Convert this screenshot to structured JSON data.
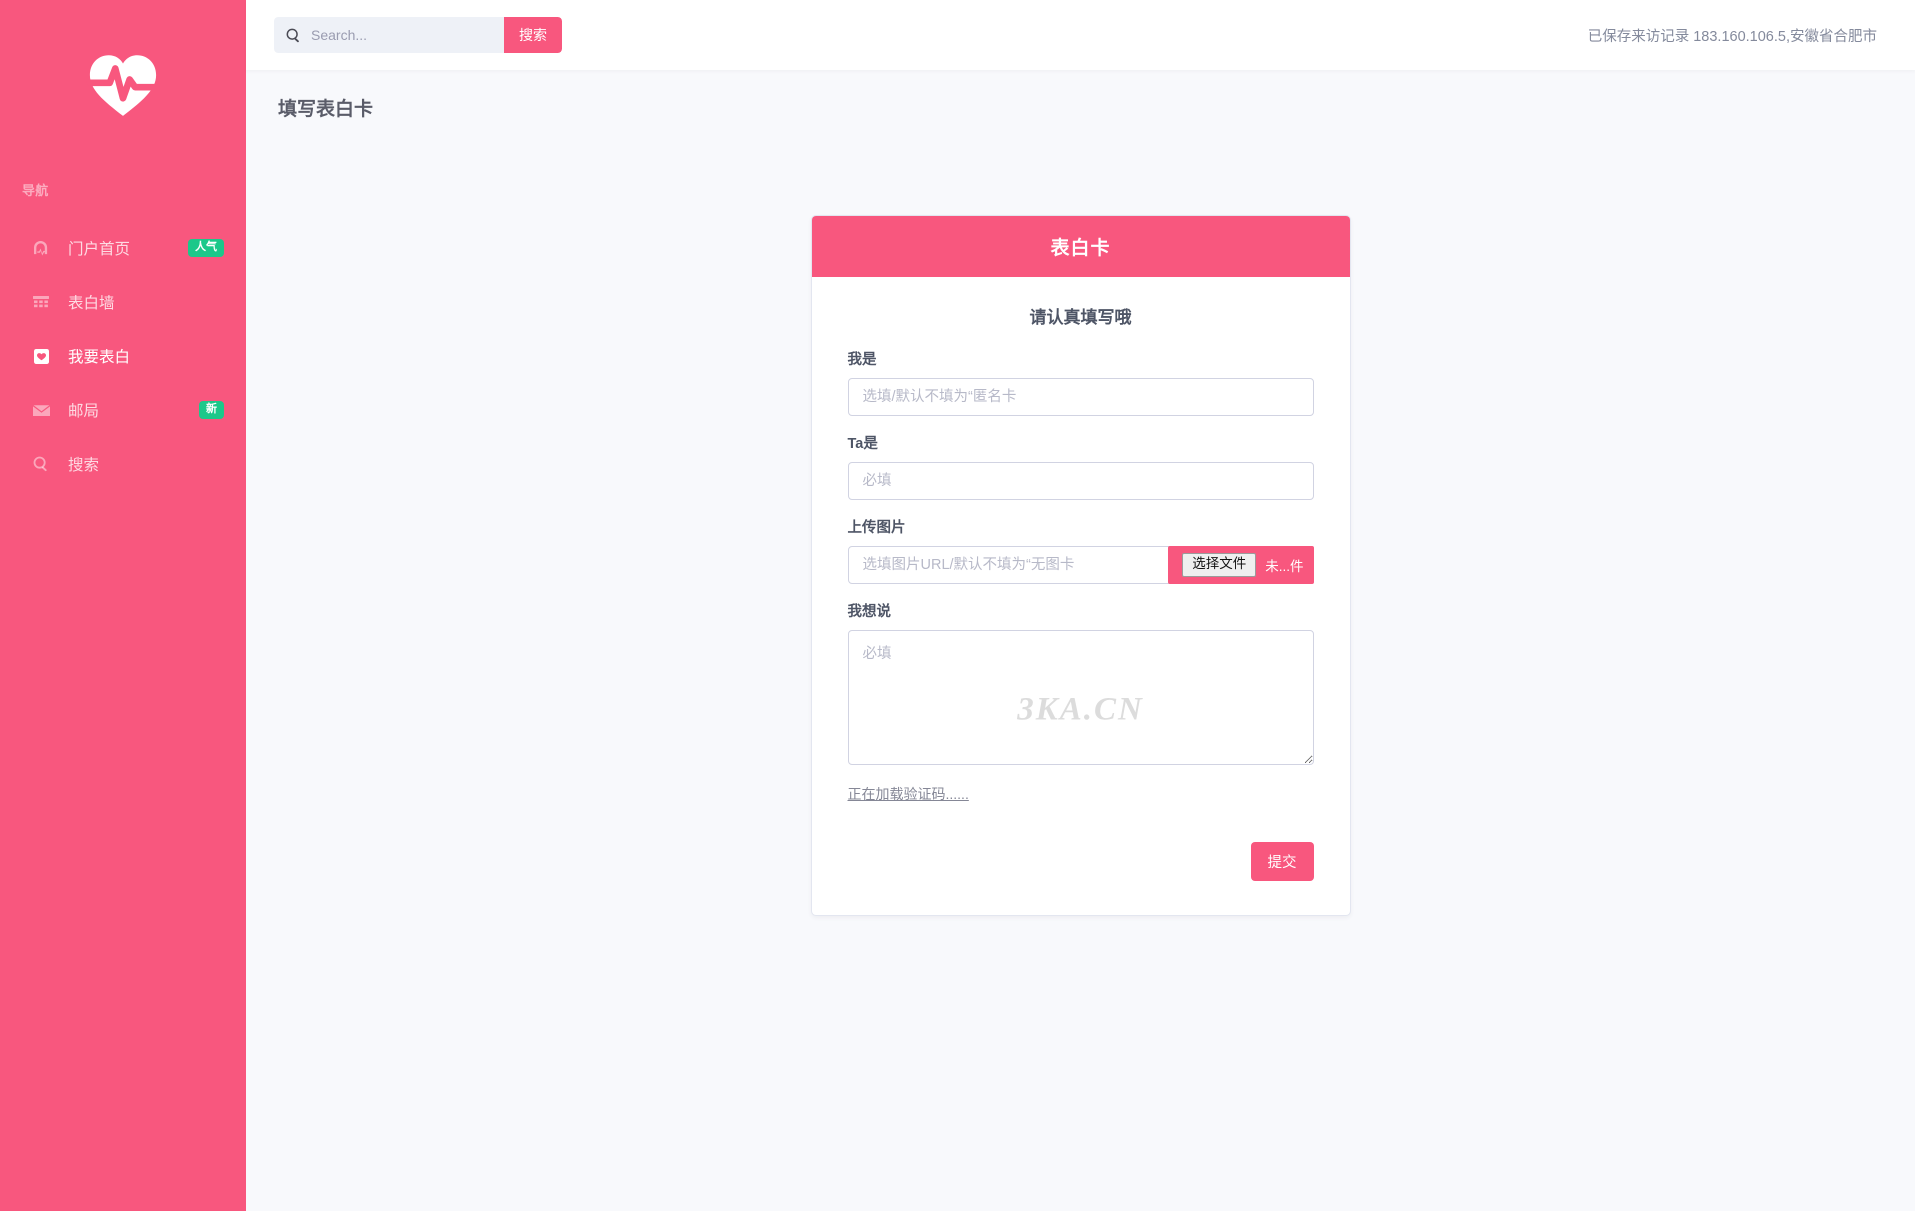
{
  "sidebar": {
    "brand_icon": "heart-pulse-icon",
    "nav_heading": "导航",
    "items": [
      {
        "label": "门户首页",
        "icon": "pulse-chart-icon",
        "badge": "人气",
        "active": false
      },
      {
        "label": "表白墙",
        "icon": "building-icon",
        "badge": "",
        "active": false
      },
      {
        "label": "我要表白",
        "icon": "heart-square-icon",
        "badge": "",
        "active": true
      },
      {
        "label": "邮局",
        "icon": "envelope-icon",
        "badge": "新",
        "active": false
      },
      {
        "label": "搜索",
        "icon": "search-icon",
        "badge": "",
        "active": false
      }
    ]
  },
  "topbar": {
    "search": {
      "icon": "search-icon",
      "placeholder": "Search...",
      "value": "",
      "button_label": "搜索"
    },
    "visit_record": "已保存来访记录 183.160.106.5,安徽省合肥市"
  },
  "page": {
    "title": "填写表白卡"
  },
  "card": {
    "header_title": "表白卡",
    "form_title": "请认真填写哦",
    "fields": {
      "sender": {
        "label": "我是",
        "placeholder": "选填/默认不填为“匿名卡",
        "value": ""
      },
      "receiver": {
        "label": "Ta是",
        "placeholder": "必填",
        "value": ""
      },
      "image": {
        "label": "上传图片",
        "placeholder": "选填图片URL/默认不填为“无图卡",
        "value": "",
        "choose_file_label": "选择文件",
        "file_status": "未...件"
      },
      "message": {
        "label": "我想说",
        "placeholder": "必填",
        "value": "",
        "watermark": "3KA.CN"
      }
    },
    "captcha_note": "正在加载验证码......",
    "submit_label": "提交"
  },
  "colors": {
    "brand_pink": "#f8577e",
    "badge_green": "#1cc88a",
    "page_bg": "#f8f9fc",
    "text_dark": "#5a5c69",
    "border": "#d1d3e2"
  }
}
